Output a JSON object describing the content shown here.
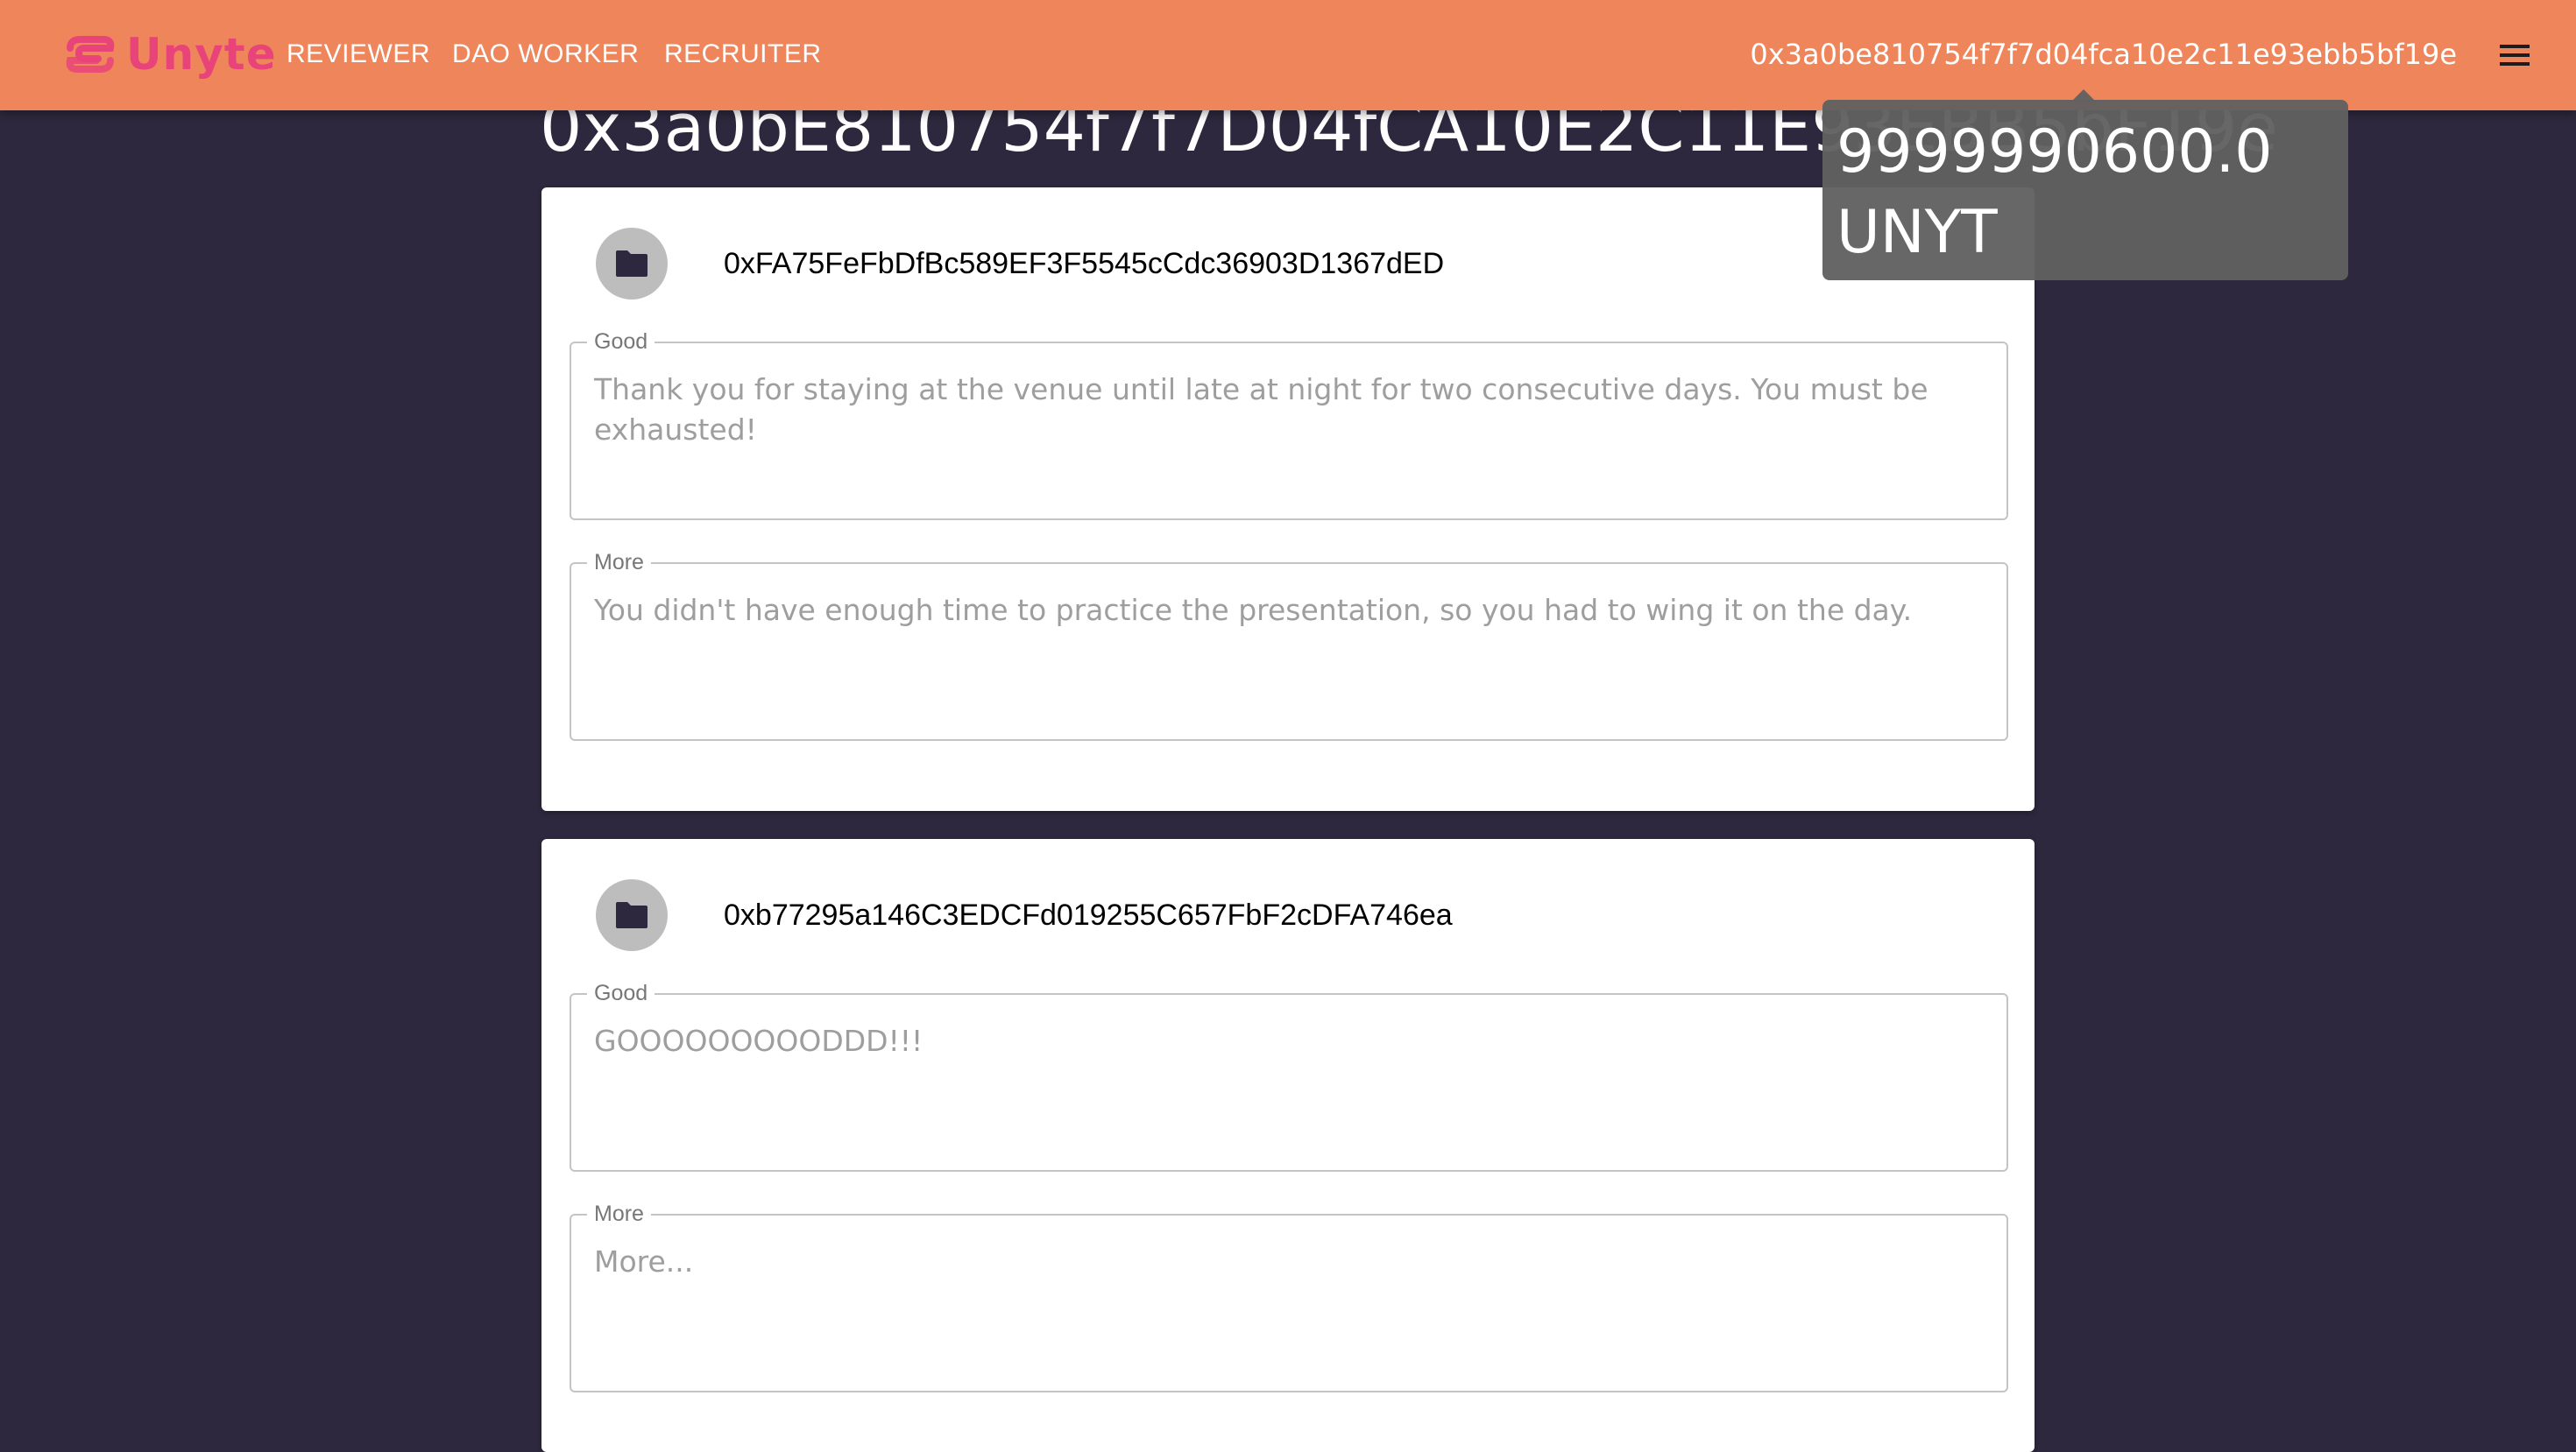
{
  "header": {
    "logo_text": "Unyte",
    "nav": [
      {
        "label": "REVIEWER"
      },
      {
        "label": "DAO WORKER"
      },
      {
        "label": "RECRUITER"
      }
    ],
    "wallet_address": "0x3a0be810754f7f7d04fca10e2c11e93ebb5bf19e",
    "menu_icon": "hamburger-menu-icon"
  },
  "page": {
    "title": "0x3a0bE810754f7f7D04fCA10E2C11E93EBB5bF19e"
  },
  "tooltip": {
    "line1": "9999990600.0",
    "line2": "UNYT"
  },
  "reviews": [
    {
      "address": "0xFA75FeFbDfBc589EF3F5545cCdc36903D1367dED",
      "icon": "folder-icon",
      "good_label": "Good",
      "good_text": "Thank you for staying at the venue until late at night for two consecutive days. You must be exhausted!",
      "more_label": "More",
      "more_text": "You didn't have enough time to practice the presentation, so you had to wing it on the day."
    },
    {
      "address": "0xb77295a146C3EDCFd019255C657FbF2cDFA746ea",
      "icon": "folder-icon",
      "good_label": "Good",
      "good_text": "GOOOOOOOOODDD!!!",
      "more_label": "More",
      "more_text": "More..."
    }
  ],
  "colors": {
    "appbar": "#ef865b",
    "background": "#2d283d",
    "logo": "#e9447a",
    "tooltip": "#616161"
  }
}
